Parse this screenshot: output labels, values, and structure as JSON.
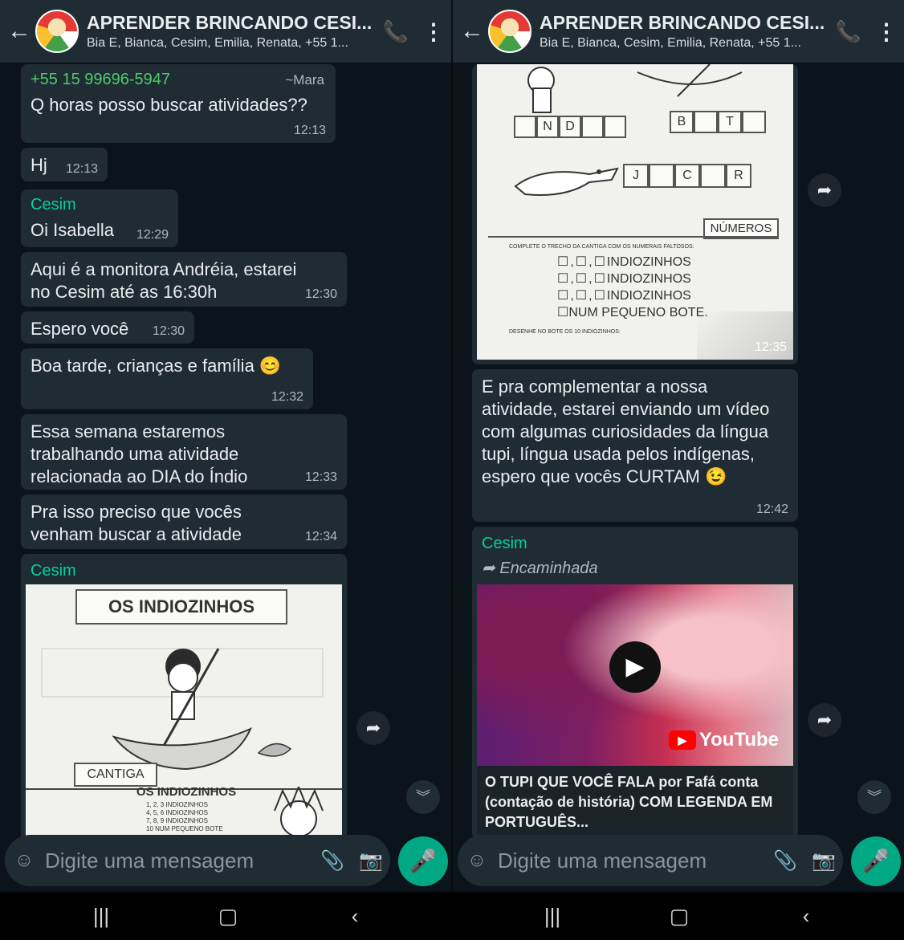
{
  "header": {
    "title": "APRENDER BRINCANDO CESI...",
    "subtitle": "Bia E, Bianca, Cesim, Emilia, Renata, +55 1..."
  },
  "left": {
    "msg1": {
      "sender": "+55 15 99696-5947",
      "alt": "~Mara",
      "text": "Q horas posso buscar atividades??",
      "time": "12:13"
    },
    "msg2": {
      "text": "Hj",
      "time": "12:13"
    },
    "msg3": {
      "sender": "Cesim",
      "text": "Oi Isabella",
      "time": "12:29"
    },
    "msg4": {
      "text": "Aqui é a monitora Andréia, estarei no Cesim até as 16:30h",
      "time": "12:30"
    },
    "msg5": {
      "text": "Espero você",
      "time": "12:30"
    },
    "msg6": {
      "text": "Boa tarde, crianças e família 😊",
      "time": "12:32"
    },
    "msg7": {
      "text": "Essa semana estaremos trabalhando uma atividade relacionada ao DIA do Índio",
      "time": "12:33"
    },
    "msg8": {
      "text": "Pra isso preciso que vocês venham buscar a atividade",
      "time": "12:34"
    },
    "msg9": {
      "sender": "Cesim",
      "worksheet_title": "OS INDIOZINHOS",
      "section": "CANTIGA",
      "song_title": "OS INDIOZINHOS",
      "song_lines": [
        "1, 2, 3 INDIOZINHOS",
        "4, 5, 6 INDIOZINHOS",
        "7, 8, 9 INDIOZINHOS",
        "10 NUM PEQUENO BOTE"
      ]
    }
  },
  "right": {
    "img": {
      "time": "12:35",
      "letters_a": [
        "",
        "N",
        "D",
        "",
        ""
      ],
      "letters_b": [
        "B",
        "",
        "T",
        ""
      ],
      "letters_c": [
        "J",
        "",
        "C",
        "",
        "R"
      ],
      "numeros_label": "NÚMEROS",
      "instruction": "COMPLETE O TRECHO DA CANTIGA COM OS NUMERAIS FALTOSOS:",
      "lines": [
        "INDIOZINHOS",
        "INDIOZINHOS",
        "INDIOZINHOS",
        "NUM PEQUENO BOTE."
      ],
      "draw_instruction": "DESENHE NO BOTE OS 10 INDIOZINHOS:"
    },
    "msg10": {
      "text": "E pra complementar a nossa atividade, estarei enviando um vídeo com algumas curiosidades da língua tupi, língua usada pelos indígenas, espero que vocês CURTAM 😉",
      "time": "12:42"
    },
    "msg11": {
      "sender": "Cesim",
      "forwarded": "Encaminhada",
      "brand": "YouTube",
      "video_title": "O TUPI QUE VOCÊ FALA por Fafá conta (contação de história) COM LEGENDA EM PORTUGUÊS..."
    }
  },
  "composer": {
    "placeholder": "Digite uma mensagem"
  }
}
